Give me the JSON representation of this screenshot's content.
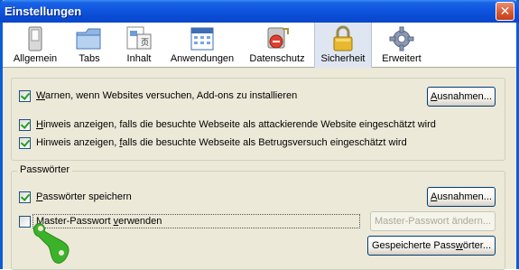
{
  "window": {
    "title": "Einstellungen",
    "close_glyph": "✕"
  },
  "toolbar": {
    "items": [
      {
        "label": "Allgemein",
        "icon": "switch-icon"
      },
      {
        "label": "Tabs",
        "icon": "tabs-folder-icon"
      },
      {
        "label": "Inhalt",
        "icon": "content-page-icon"
      },
      {
        "label": "Anwendungen",
        "icon": "calendar-icon"
      },
      {
        "label": "Datenschutz",
        "icon": "privacy-icon"
      },
      {
        "label": "Sicherheit",
        "icon": "lock-icon",
        "active": true
      },
      {
        "label": "Erweitert",
        "icon": "gear-icon"
      }
    ]
  },
  "security": {
    "addons": {
      "prefix": "W",
      "rest": "arnen, wenn Websites versuchen, Add-ons zu installieren",
      "checked": true
    },
    "addons_exceptions": {
      "prefix": "A",
      "rest": "usnahmen..."
    },
    "attack": {
      "prefix": "H",
      "rest": "inweis anzeigen, falls die besuchte Webseite als attackierende Website eingeschätzt wird",
      "checked": true
    },
    "fraud": {
      "pre": "Hinweis anzeigen, ",
      "u": "f",
      "post": "alls die besuchte Webseite als Betrugsversuch eingeschätzt wird",
      "checked": true
    }
  },
  "passwords": {
    "group_label": "Passwörter",
    "save": {
      "prefix": "P",
      "rest": "asswörter speichern",
      "checked": true
    },
    "save_exceptions": {
      "prefix": "A",
      "rest": "usnahmen..."
    },
    "master": {
      "pre": "Master-Passwort ",
      "u": "v",
      "post": "erwenden",
      "checked": false
    },
    "change_master": {
      "label": "Master-Passwort ändern...",
      "disabled": true
    },
    "saved_passwords": {
      "pre": "Gespeicherte Pass",
      "u": "w",
      "post": "örter..."
    }
  },
  "colors": {
    "titlebar": "#0a4ad2",
    "dialog_bg": "#ece9d8",
    "cursor": "#3cb22b"
  }
}
